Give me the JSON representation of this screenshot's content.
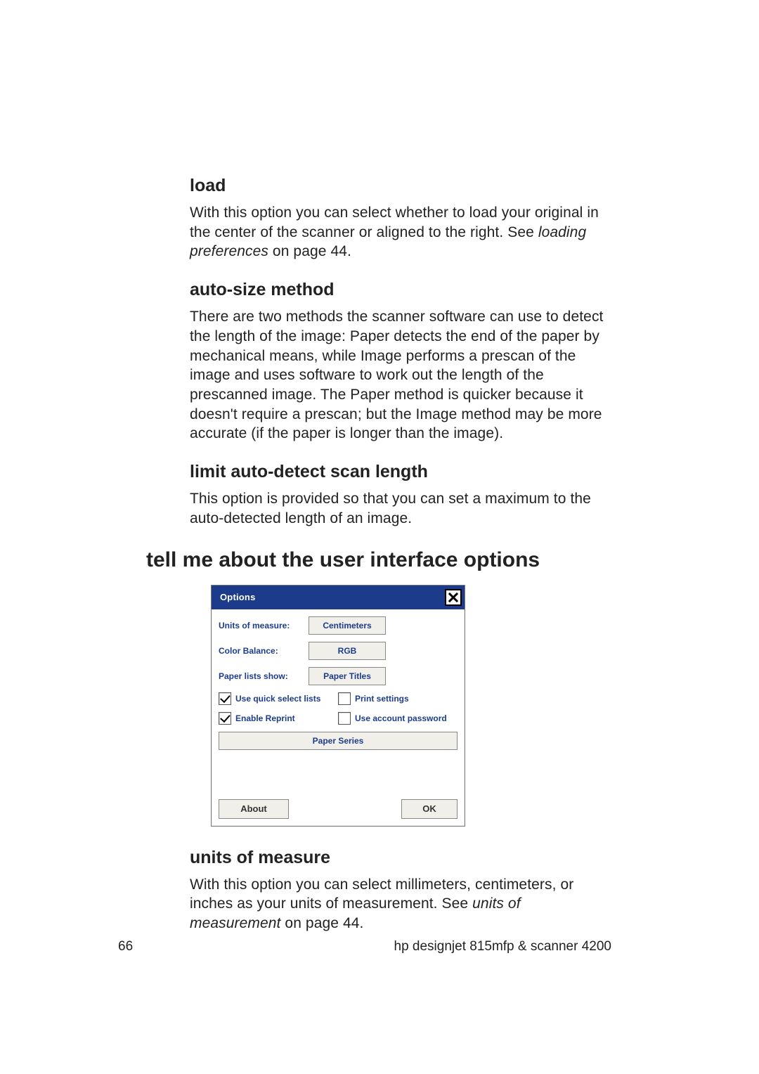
{
  "page_number": "66",
  "footer_right": "hp designjet 815mfp & scanner 4200",
  "sections": {
    "load": {
      "title": "load",
      "body_a": "With this option you can select whether to load your original in the center of the scanner or aligned to the right. See ",
      "body_italic": "loading preferences",
      "body_b": " on page 44."
    },
    "autosize": {
      "title": "auto-size method",
      "body": "There are two methods the scanner software can use to detect the length of the image: Paper detects the end of the paper by mechanical means, while Image performs a prescan of the image and uses software to work out the length of the prescanned image. The Paper method is quicker because it doesn't require a prescan; but the Image method may be more accurate (if the paper is longer than the image)."
    },
    "limit": {
      "title": "limit auto-detect scan length",
      "body": "This option is provided so that you can set a maximum to the auto-detected length of an image."
    },
    "ui_heading": "tell me about the user interface options",
    "units": {
      "title": "units of measure",
      "body_a": "With this option you can select millimeters, centimeters, or inches as your units of measurement. See ",
      "body_italic": "units of measurement",
      "body_b": " on page 44."
    }
  },
  "dialog": {
    "title": "Options",
    "rows": {
      "units": {
        "label": "Units of measure:",
        "value": "Centimeters"
      },
      "color": {
        "label": "Color Balance:",
        "value": "RGB"
      },
      "paper": {
        "label": "Paper lists show:",
        "value": "Paper Titles"
      }
    },
    "checks": {
      "quick": {
        "label": "Use quick select lists",
        "checked": true
      },
      "printsettings": {
        "label": "Print settings",
        "checked": false
      },
      "reprint": {
        "label": "Enable Reprint",
        "checked": true
      },
      "acctpw": {
        "label": "Use account password",
        "checked": false
      }
    },
    "paper_series": "Paper Series",
    "about": "About",
    "ok": "OK"
  }
}
